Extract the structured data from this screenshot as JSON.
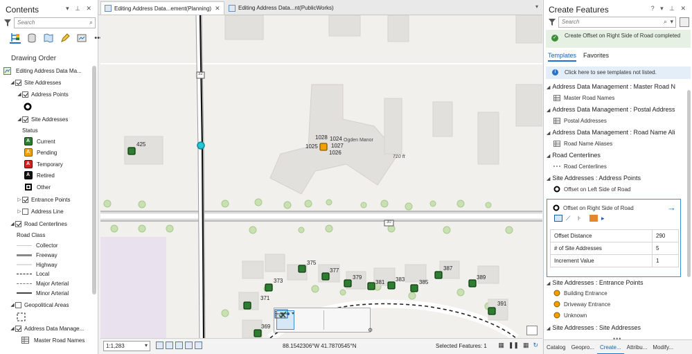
{
  "contents": {
    "title": "Contents",
    "search_placeholder": "Search",
    "drawing_order_label": "Drawing Order",
    "map_name": "Editing Address Data Ma...",
    "layers": {
      "site_addresses": "Site Addresses",
      "address_points": "Address Points",
      "site_addresses_sub": "Site Addresses",
      "status_label": "Status",
      "status_items": [
        "Current",
        "Pending",
        "Temporary",
        "Retired",
        "Other"
      ],
      "entrance_points": "Entrance Points",
      "address_line": "Address Line",
      "road_centerlines": "Road Centerlines",
      "road_class_label": "Road Class",
      "road_classes": [
        "Collector",
        "Freeway",
        "Highway",
        "Local",
        "Major Arterial",
        "Minor Arterial"
      ],
      "geopolitical_areas": "Geopolitical Areas",
      "address_data_mgmt": "Address Data Manage...",
      "master_road_names": "Master Road Names"
    }
  },
  "tabs": [
    {
      "label": "Editing Address Data...ement(Planning)",
      "active": true
    },
    {
      "label": "Editing Address Data...nt(PublicWorks)",
      "active": false
    }
  ],
  "map": {
    "labels": {
      "p425": "425",
      "p1028": "1028",
      "p1024": "1024",
      "p1025": "1025",
      "p1027": "1027",
      "p1026": "1026",
      "ogden": "Ogden Manor",
      "ft": "710 ft",
      "hwy32": "32",
      "hwy30": "30",
      "p375": "375",
      "p377": "377",
      "p379": "379",
      "p381": "381",
      "p383": "383",
      "p385": "385",
      "p387": "387",
      "p389": "389",
      "p391": "391",
      "p373": "373",
      "p371": "371",
      "p369": "369"
    }
  },
  "status": {
    "scale": "1:1,283",
    "coordinates": "88.1542306°W 41.7870545°N",
    "selected_features": "Selected Features: 1"
  },
  "create_features": {
    "title": "Create Features",
    "search_placeholder": "Search",
    "notice": "Create Offset on Right Side of Road completed",
    "tab_templates": "Templates",
    "tab_favorites": "Favorites",
    "info": "Click here to see templates not listed.",
    "groups": [
      {
        "title": "Address Data Management : Master Road N",
        "item": "Master Road Names"
      },
      {
        "title": "Address Data Management : Postal Address",
        "item": "Postal Addresses"
      },
      {
        "title": "Address Data Management : Road Name Ali",
        "item": "Road Name Aliases"
      },
      {
        "title": "Road Centerlines",
        "item": "Road Centerlines"
      },
      {
        "title": "Site Addresses : Address Points",
        "item": "Offset on Left Side of Road"
      }
    ],
    "selected_template": "Offset on Right Side of Road",
    "attributes": [
      {
        "name": "Offset Distance",
        "value": "290"
      },
      {
        "name": "# of Site Addresses",
        "value": "5"
      },
      {
        "name": "Increment Value",
        "value": "1"
      }
    ],
    "entrance_group": "Site Addresses : Entrance Points",
    "entrance_items": [
      "Building Entrance",
      "Driveway Entrance",
      "Unknown"
    ],
    "site_group": "Site Addresses : Site Addresses",
    "bottom_tabs": [
      "Catalog",
      "Geopro...",
      "Create...",
      "Attribu...",
      "Modify..."
    ]
  },
  "colors": {
    "current": "#2e7d32",
    "pending": "#f0a000",
    "temporary": "#d42020",
    "retired": "#111111",
    "accent": "#1a73c9"
  }
}
